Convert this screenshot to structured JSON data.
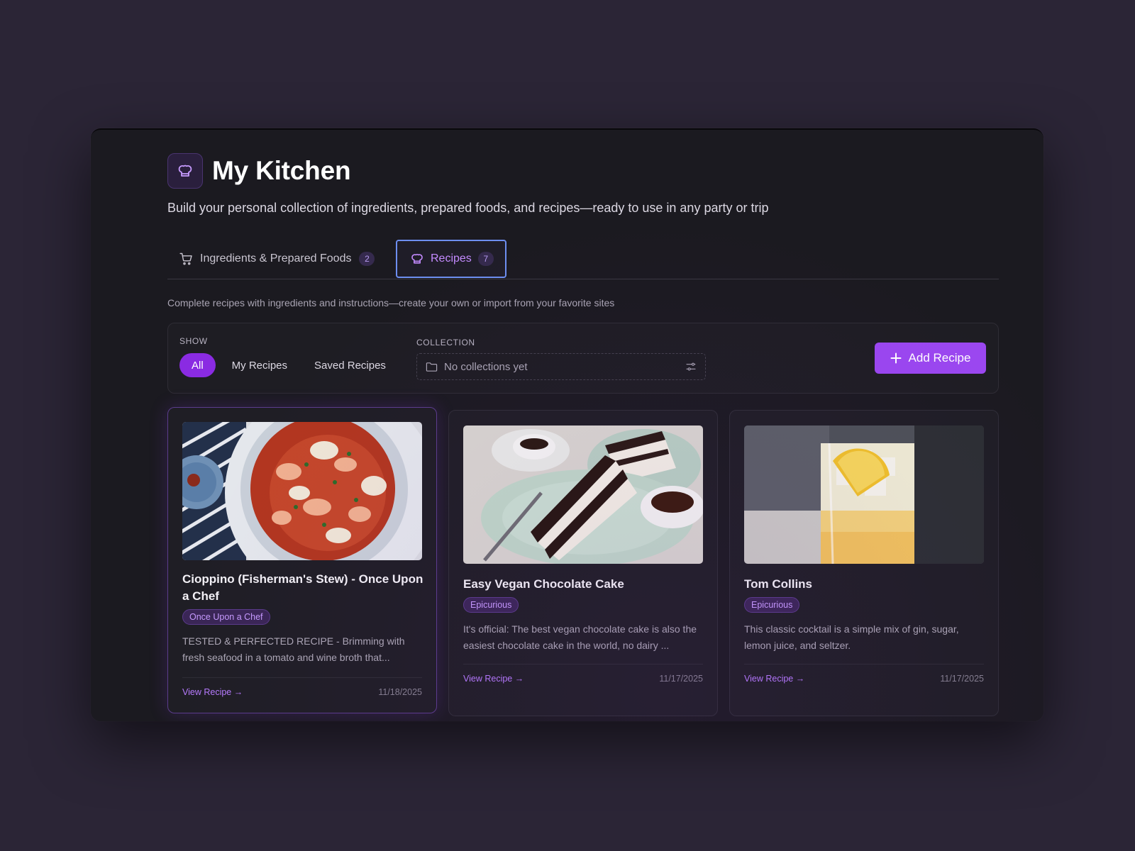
{
  "app": {
    "title": "My Kitchen",
    "subtitle": "Build your personal collection of ingredients, prepared foods, and recipes—ready to use in any party or trip",
    "logo_icon": "chef-hat-icon"
  },
  "tabs": [
    {
      "label": "Ingredients & Prepared Foods",
      "count": "2",
      "icon": "cart-icon",
      "active": false
    },
    {
      "label": "Recipes",
      "count": "7",
      "icon": "chef-hat-icon",
      "active": true
    }
  ],
  "recipes_description": "Complete recipes with ingredients and instructions—create your own or import from your favorite sites",
  "filter": {
    "show_label": "SHOW",
    "show_options": [
      "All",
      "My Recipes",
      "Saved Recipes"
    ],
    "selected": "All",
    "collection_label": "COLLECTION",
    "collection_value": "No collections yet",
    "add_button": "Add Recipe"
  },
  "recipes": [
    {
      "title": "Cioppino (Fisherman's Stew) - Once Upon a Chef",
      "source": "Once Upon a Chef",
      "description": "TESTED & PERFECTED RECIPE - Brimming with fresh seafood in a tomato and wine broth that...",
      "link": "View Recipe →",
      "date": "11/18/2025",
      "image": "seafood-stew-photo"
    },
    {
      "title": "Easy Vegan Chocolate Cake",
      "source": "Epicurious",
      "description": "It's official: The best vegan chocolate cake is also the easiest chocolate cake in the world, no dairy ...",
      "link": "View Recipe →",
      "date": "11/17/2025",
      "image": "chocolate-cake-photo"
    },
    {
      "title": "Tom Collins",
      "source": "Epicurious",
      "description": "This classic cocktail is a simple mix of gin, sugar, lemon juice, and seltzer.",
      "link": "View Recipe →",
      "date": "11/17/2025",
      "image": "cocktail-photo"
    }
  ],
  "colors": {
    "accent": "#9b47f0",
    "active_pill": "#8a2be2",
    "background": "#2b2536",
    "panel": "#1b1a20",
    "link": "#b77bff",
    "focus_ring": "#6d8ef0"
  }
}
